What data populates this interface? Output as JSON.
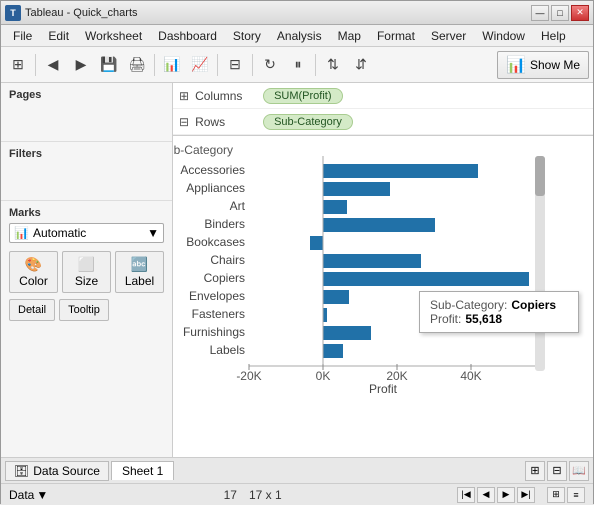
{
  "titleBar": {
    "title": "Tableau - Quick_charts",
    "icon": "T",
    "controls": [
      "—",
      "□",
      "✕"
    ]
  },
  "menuBar": {
    "items": [
      "File",
      "Edit",
      "Worksheet",
      "Dashboard",
      "Story",
      "Analysis",
      "Map",
      "Format",
      "Server",
      "Window",
      "Help"
    ]
  },
  "toolbar": {
    "showMeLabel": "Show Me"
  },
  "shelves": {
    "columnsLabel": "Columns",
    "columnsPill": "SUM(Profit)",
    "rowsLabel": "Rows",
    "rowsPill": "Sub-Category"
  },
  "leftPanel": {
    "pagesLabel": "Pages",
    "filtersLabel": "Filters",
    "marksLabel": "Marks",
    "marksDropdown": "Automatic",
    "colorLabel": "Color",
    "sizeLabel": "Size",
    "labelLabel": "Label",
    "detailLabel": "Detail",
    "tooltipLabel": "Tooltip"
  },
  "chart": {
    "title": "Sub-Category",
    "xAxisLabel": "Profit",
    "xAxisTicks": [
      "-20K",
      "0K",
      "20K",
      "40K"
    ],
    "bars": [
      {
        "label": "Accessories",
        "value": 41936,
        "pct": 0.72
      },
      {
        "label": "Appliances",
        "value": 18138,
        "pct": 0.38
      },
      {
        "label": "Art",
        "value": 6528,
        "pct": 0.22
      },
      {
        "label": "Binders",
        "value": 30221,
        "pct": 0.58
      },
      {
        "label": "Bookcases",
        "value": -3472,
        "pct": -0.08
      },
      {
        "label": "Chairs",
        "value": 26590,
        "pct": 0.5
      },
      {
        "label": "Copiers",
        "value": 55618,
        "pct": 0.96
      },
      {
        "label": "Envelopes",
        "value": 6964,
        "pct": 0.23
      },
      {
        "label": "Fasteners",
        "value": 950,
        "pct": 0.1
      },
      {
        "label": "Furnishings",
        "value": 13059,
        "pct": 0.3
      },
      {
        "label": "Labels",
        "value": 5546,
        "pct": 0.18
      }
    ],
    "zeroLineX": 0.27
  },
  "tooltip": {
    "subcategoryLabel": "Sub-Category:",
    "subcategoryValue": "Copiers",
    "profitLabel": "Profit:",
    "profitValue": "55,618"
  },
  "tabs": {
    "datasourceLabel": "Data Source",
    "sheetLabel": "Sheet 1"
  },
  "statusBar": {
    "datasource": "Data",
    "rows": "17",
    "dimensions": "17 x 1"
  }
}
